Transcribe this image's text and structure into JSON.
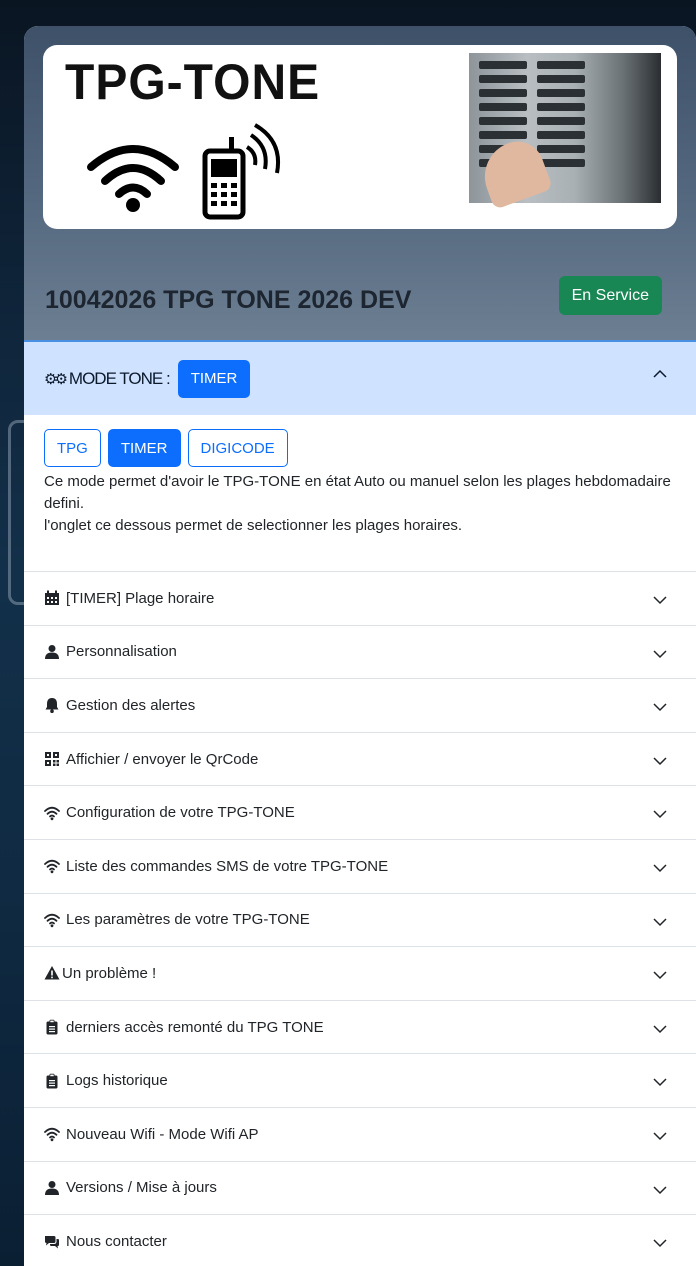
{
  "brand": {
    "title": "TPG-TONE"
  },
  "device": {
    "title": "10042026 TPG TONE 2026 DEV",
    "status": "En Service"
  },
  "colors": {
    "accent": "#0d6efd",
    "status": "#198754",
    "header_bg": "#cfe2ff"
  },
  "mode": {
    "label": "MODE TONE :",
    "current": "TIMER",
    "options": [
      "TPG",
      "TIMER",
      "DIGICODE"
    ],
    "description": [
      "Ce mode permet d'avoir le TPG-TONE en état Auto ou manuel selon les plages hebdomadaire defini.",
      "l'onglet ce dessous permet de selectionner les plages horaires."
    ]
  },
  "accordion": [
    {
      "icon": "calendar-icon",
      "label": "[TIMER] Plage horaire"
    },
    {
      "icon": "user-icon",
      "label": "Personnalisation"
    },
    {
      "icon": "bell-icon",
      "label": "Gestion des alertes"
    },
    {
      "icon": "qrcode-icon",
      "label": "Affichier / envoyer le QrCode"
    },
    {
      "icon": "wifi-icon",
      "label": "Configuration de votre TPG-TONE"
    },
    {
      "icon": "wifi-icon",
      "label": "Liste des commandes SMS de votre TPG-TONE"
    },
    {
      "icon": "wifi-icon",
      "label": "Les paramètres de votre TPG-TONE"
    },
    {
      "icon": "warning-icon",
      "label": "Un problème !"
    },
    {
      "icon": "clipboard-icon",
      "label": "derniers accès remonté du TPG TONE"
    },
    {
      "icon": "clipboard-icon",
      "label": "Logs historique"
    },
    {
      "icon": "wifi-icon",
      "label": "Nouveau Wifi - Mode Wifi AP"
    },
    {
      "icon": "user-icon",
      "label": "Versions / Mise à jours"
    },
    {
      "icon": "comments-icon",
      "label": "Nous contacter"
    }
  ]
}
